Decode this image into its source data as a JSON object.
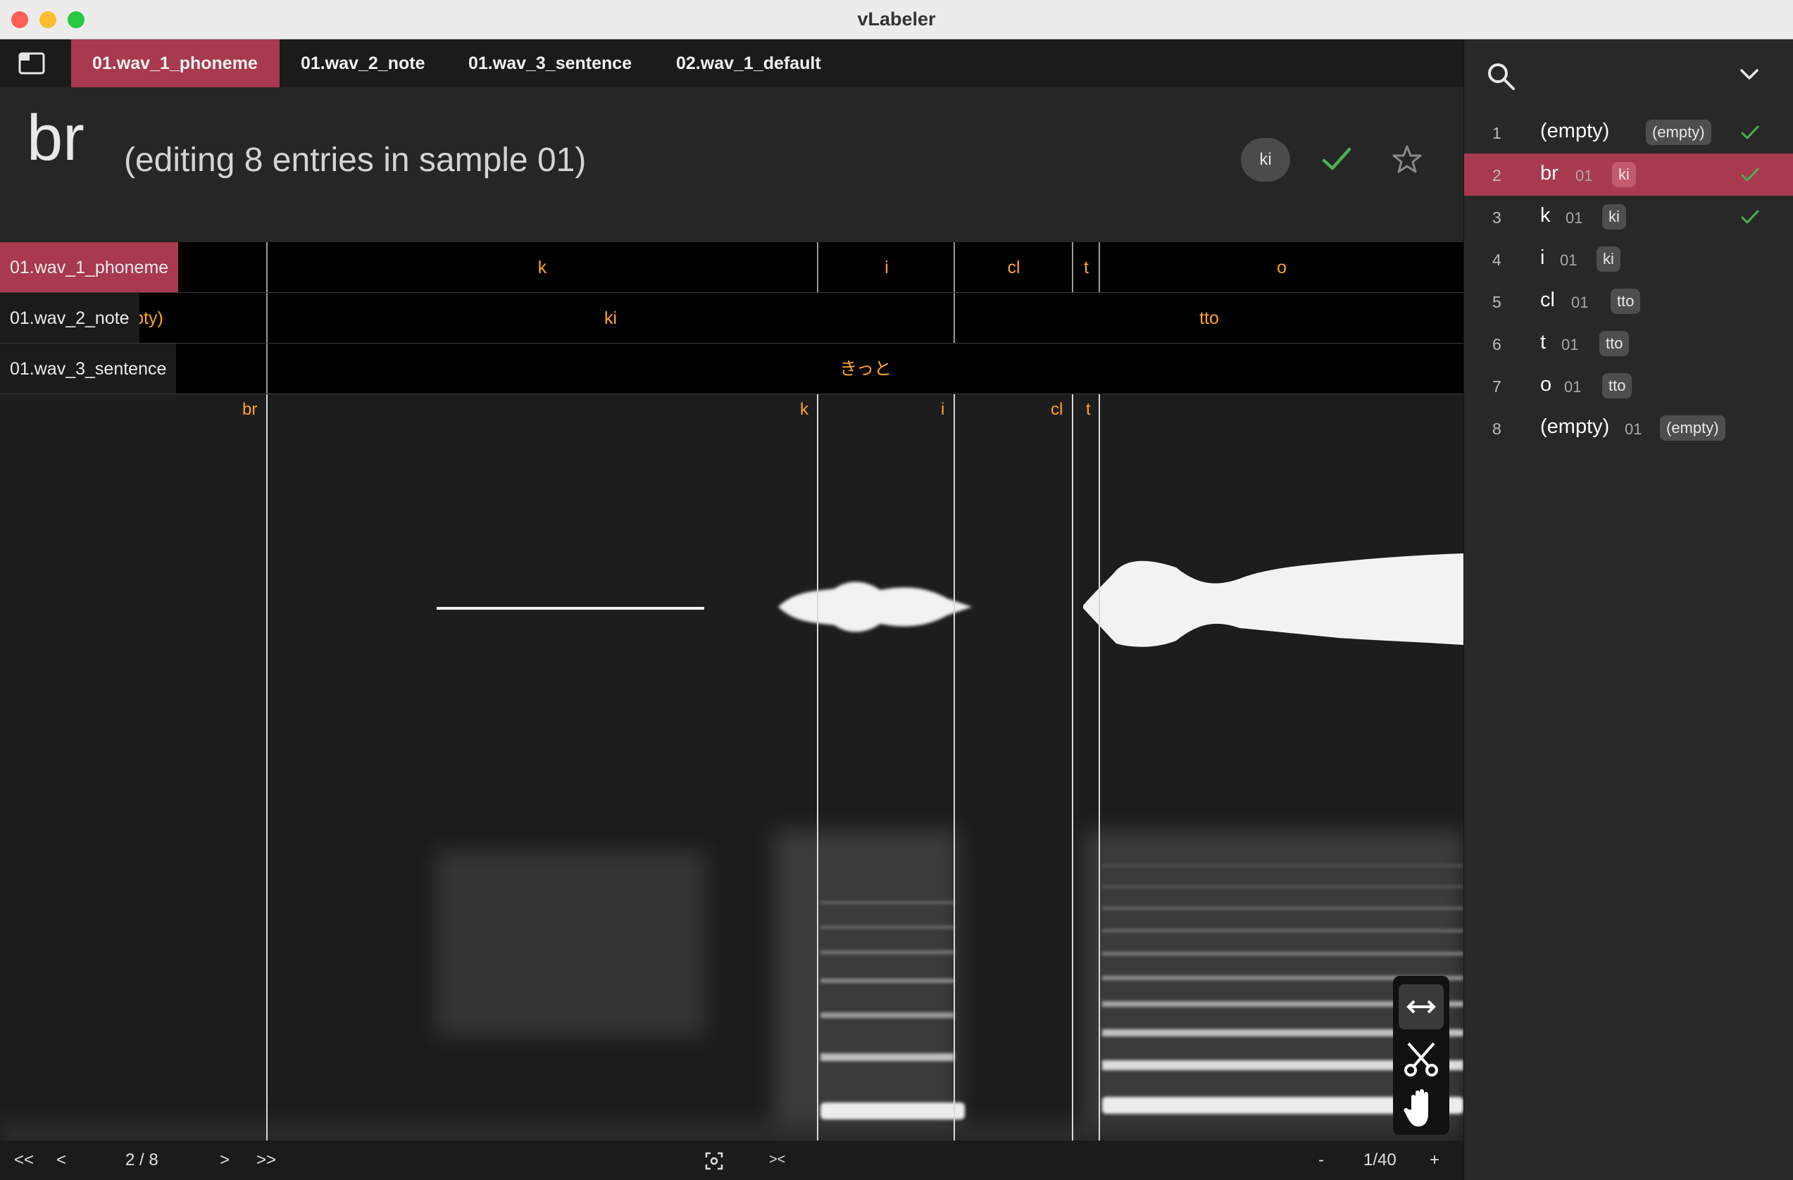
{
  "window": {
    "title": "vLabeler"
  },
  "colors": {
    "accent": "#a8394e",
    "label_orange": "#ffa526",
    "check_green": "#4caf50"
  },
  "tabs": [
    {
      "label": "01.wav_1_phoneme",
      "active": true
    },
    {
      "label": "01.wav_2_note",
      "active": false
    },
    {
      "label": "01.wav_3_sentence",
      "active": false
    },
    {
      "label": "02.wav_1_default",
      "active": false
    }
  ],
  "header": {
    "entry_name": "br",
    "entry_info": "(editing 8 entries in sample 01)",
    "tag": "ki"
  },
  "lanes": {
    "phoneme": {
      "name": "01.wav_1_phoneme",
      "segments": [
        "k",
        "i",
        "cl",
        "t",
        "o"
      ]
    },
    "note": {
      "name": "01.wav_2_note",
      "cut_label": "pty)",
      "segments": [
        "ki",
        "tto"
      ]
    },
    "sentence": {
      "name": "01.wav_3_sentence",
      "segments": [
        "きっと"
      ]
    }
  },
  "markers": [
    "br",
    "k",
    "i",
    "cl",
    "t"
  ],
  "bottom": {
    "first": "<<",
    "prev": "<",
    "position": "2 / 8",
    "next": ">",
    "last": ">>",
    "focus_icon": "focus-icon",
    "collapse": "><",
    "zoom_out": "-",
    "zoom": "1/40",
    "zoom_in": "+"
  },
  "tools": [
    "resize-arrows-icon",
    "scissors-icon",
    "hand-icon"
  ],
  "entries": [
    {
      "num": "1",
      "name": "(empty)",
      "sample": "",
      "tag": "(empty)",
      "done": true,
      "selected": false
    },
    {
      "num": "2",
      "name": "br",
      "sample": "01",
      "tag": "ki",
      "done": true,
      "selected": true
    },
    {
      "num": "3",
      "name": "k",
      "sample": "01",
      "tag": "ki",
      "done": true,
      "selected": false
    },
    {
      "num": "4",
      "name": "i",
      "sample": "01",
      "tag": "ki",
      "done": false,
      "selected": false
    },
    {
      "num": "5",
      "name": "cl",
      "sample": "01",
      "tag": "tto",
      "done": false,
      "selected": false
    },
    {
      "num": "6",
      "name": "t",
      "sample": "01",
      "tag": "tto",
      "done": false,
      "selected": false
    },
    {
      "num": "7",
      "name": "o",
      "sample": "01",
      "tag": "tto",
      "done": false,
      "selected": false
    },
    {
      "num": "8",
      "name": "(empty)",
      "sample": "01",
      "tag": "(empty)",
      "done": false,
      "selected": false
    }
  ]
}
